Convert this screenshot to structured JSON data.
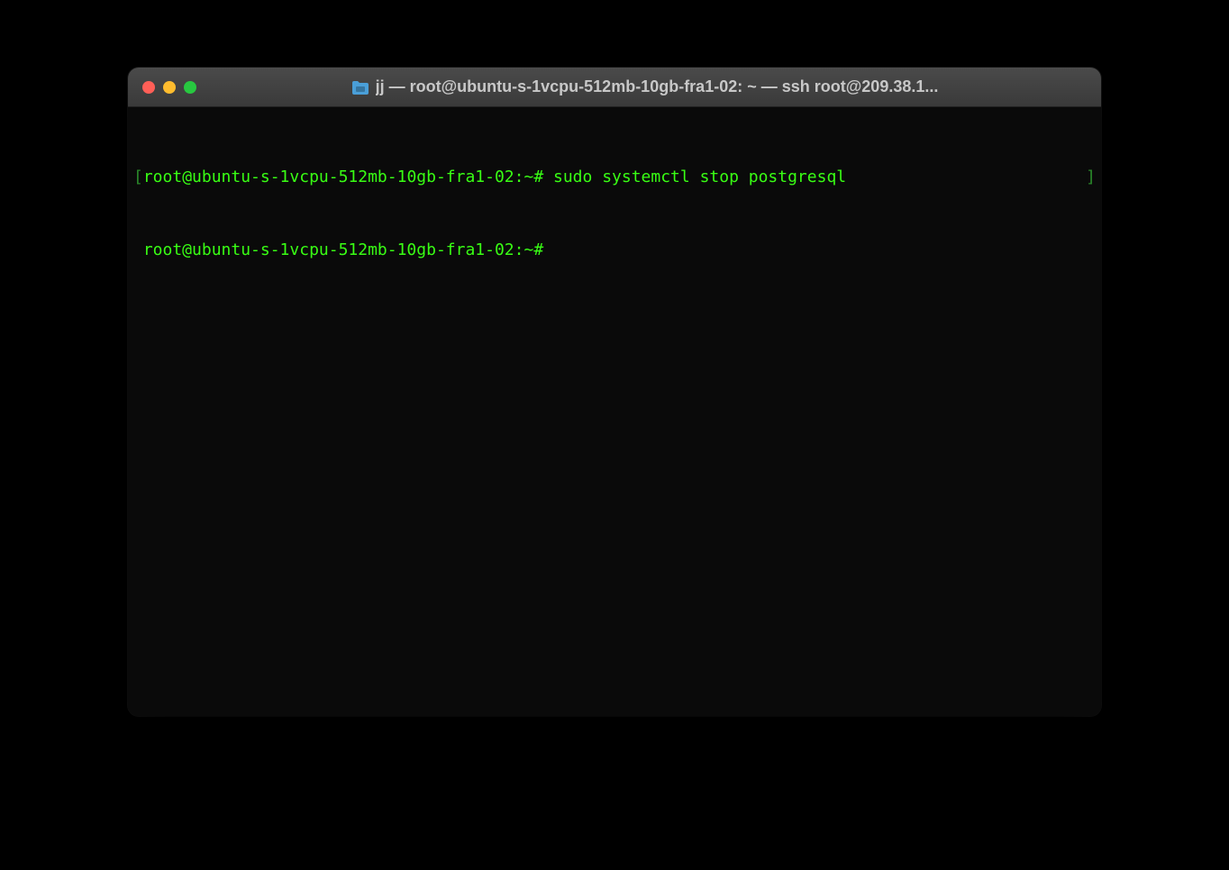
{
  "window": {
    "title": "jj — root@ubuntu-s-1vcpu-512mb-10gb-fra1-02: ~ — ssh root@209.38.1..."
  },
  "terminal": {
    "bracket_open": "[",
    "bracket_close": "]",
    "line1_prompt": "root@ubuntu-s-1vcpu-512mb-10gb-fra1-02:~#",
    "line1_command": " sudo systemctl stop postgresql",
    "line2_prompt": " root@ubuntu-s-1vcpu-512mb-10gb-fra1-02:~# "
  },
  "colors": {
    "green": "#39ff14",
    "dim_green": "#2a8a2a",
    "background": "#0a0a0a",
    "titlebar": "#3f3f3f"
  }
}
